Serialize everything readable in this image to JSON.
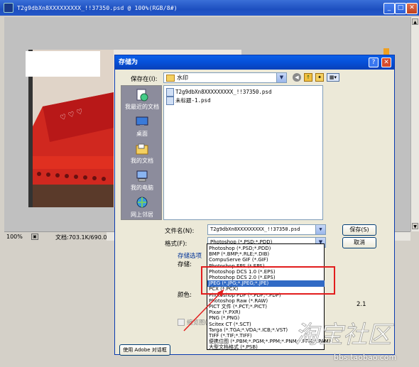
{
  "ps_window": {
    "title": "T2g9dbXn8XXXXXXXXX_!!37350.psd @ 100%(RGB/8#)",
    "zoom": "100%",
    "doc_info": "文档:703.1K/690.0K",
    "min_glyph": "_",
    "max_glyph": "□",
    "close_glyph": "✕"
  },
  "dialog": {
    "title": "存储为",
    "help_glyph": "?",
    "close_glyph": "✕",
    "save_in_label": "保存在(I):",
    "save_in_value": "水印",
    "places": [
      {
        "label": "我最近的文档",
        "icon": "recent-documents-icon"
      },
      {
        "label": "桌面",
        "icon": "desktop-icon"
      },
      {
        "label": "我的文档",
        "icon": "my-documents-icon"
      },
      {
        "label": "我的电脑",
        "icon": "my-computer-icon"
      },
      {
        "label": "网上邻居",
        "icon": "network-icon"
      }
    ],
    "files": [
      "T2g9dbXn8XXXXXXXXX_!!37350.psd",
      "未标题-1.psd"
    ],
    "filename_label": "文件名(N):",
    "filename_value": "T2g9dbXn8XXXXXXXXX_!!37350.psd",
    "format_label": "格式(F):",
    "format_value": "Photoshop (*.PSD;*.PDD)",
    "save_button": "保存(S)",
    "cancel_button": "取消",
    "save_options_label": "存储选项",
    "save_label": "存储:",
    "color_label": "颜色:",
    "thumbnail_label": "缩览图(",
    "use_adobe_dialog": "使用 Adobe 对话框",
    "partial_value": "2.1",
    "format_options": [
      "Photoshop (*.PSD;*.PDD)",
      "BMP (*.BMP;*.RLE;*.DIB)",
      "CompuServe GIF (*.GIF)",
      "Photoshop EPS (*.EPS)",
      "Photoshop DCS 1.0 (*.EPS)",
      "Photoshop DCS 2.0 (*.EPS)",
      "JPEG (*.JPG;*.JPEG;*.JPE)",
      "PCX (*.PCX)",
      "Photoshop PDF (*.PDF;*.PDP)",
      "Photoshop Raw (*.RAW)",
      "PICT 文件 (*.PCT;*.PICT)",
      "Pixar (*.PXR)",
      "PNG (*.PNG)",
      "Scitex CT (*.SCT)",
      "Targa (*.TGA;*.VDA;*.ICB;*.VST)",
      "TIFF (*.TIF;*.TIFF)",
      "便携位图 (*.PBM;*.PGM;*.PPM;*.PNM;*.PFM;*.PAM)",
      "大型文档格式 (*.PSB)"
    ],
    "selected_format_index": 6
  },
  "watermark": {
    "text": "bbs.taobao.com"
  }
}
